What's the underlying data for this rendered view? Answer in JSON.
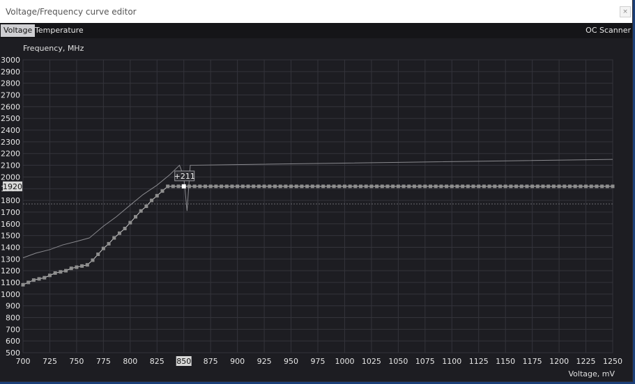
{
  "window": {
    "title": "Voltage/Frequency curve editor",
    "close_glyph": "×"
  },
  "tabs": [
    {
      "label": "Voltage",
      "active": true
    },
    {
      "label": "Temperature",
      "active": false
    }
  ],
  "oc_scanner_label": "OC Scanner",
  "colors": {
    "background": "#1d1d22",
    "grid": "#34343b",
    "curve": "#cfcfcf",
    "point": "#8e8e8e",
    "selected_point": "#ffffff"
  },
  "chart_data": {
    "type": "line",
    "xlabel": "Voltage, mV",
    "ylabel": "Frequency, MHz",
    "xlim": [
      700,
      1250
    ],
    "ylim": [
      500,
      3000
    ],
    "x_ticks": [
      700,
      725,
      750,
      775,
      800,
      825,
      850,
      875,
      900,
      925,
      950,
      975,
      1000,
      1025,
      1050,
      1075,
      1100,
      1125,
      1150,
      1175,
      1200,
      1225,
      1250
    ],
    "y_ticks": [
      500,
      600,
      700,
      800,
      900,
      1000,
      1100,
      1200,
      1300,
      1400,
      1500,
      1600,
      1700,
      1800,
      1900,
      2000,
      2100,
      2200,
      2300,
      2400,
      2500,
      2600,
      2700,
      2800,
      2900,
      3000
    ],
    "grid": true,
    "selected_voltage_label": "850",
    "selected_frequency_label": "1920",
    "offset_label": "+211",
    "reference_line_mhz": 1770,
    "series": [
      {
        "role": "reference curve",
        "x": [
          700,
          712,
          725,
          737,
          750,
          762,
          775,
          787,
          800,
          812,
          825,
          837,
          846,
          850,
          853,
          856,
          1250
        ],
        "y": [
          1310,
          1350,
          1380,
          1420,
          1450,
          1480,
          1580,
          1660,
          1760,
          1850,
          1930,
          2020,
          2100,
          2000,
          1710,
          2100,
          2150
        ]
      },
      {
        "role": "adjusted curve points",
        "x": [
          700,
          705,
          710,
          715,
          720,
          725,
          730,
          735,
          740,
          745,
          750,
          755,
          760,
          765,
          770,
          775,
          780,
          785,
          790,
          795,
          800,
          805,
          810,
          815,
          820,
          825,
          830,
          835,
          840,
          845,
          850,
          855,
          860,
          865,
          870,
          875,
          880,
          885,
          890,
          895,
          900,
          905,
          910,
          915,
          920,
          925,
          930,
          935,
          940,
          945,
          950,
          955,
          960,
          965,
          970,
          975,
          980,
          985,
          990,
          995,
          1000,
          1005,
          1010,
          1015,
          1020,
          1025,
          1030,
          1035,
          1040,
          1045,
          1050,
          1055,
          1060,
          1065,
          1070,
          1075,
          1080,
          1085,
          1090,
          1095,
          1100,
          1105,
          1110,
          1115,
          1120,
          1125,
          1130,
          1135,
          1140,
          1145,
          1150,
          1155,
          1160,
          1165,
          1170,
          1175,
          1180,
          1185,
          1190,
          1195,
          1200,
          1205,
          1210,
          1215,
          1220,
          1225,
          1230,
          1235,
          1240,
          1245,
          1250
        ],
        "y": [
          1080,
          1100,
          1120,
          1130,
          1140,
          1160,
          1180,
          1190,
          1200,
          1220,
          1230,
          1240,
          1250,
          1290,
          1340,
          1390,
          1430,
          1480,
          1520,
          1560,
          1610,
          1660,
          1710,
          1750,
          1800,
          1840,
          1880,
          1920,
          1920,
          1920,
          1920,
          1920,
          1920,
          1920,
          1920,
          1920,
          1920,
          1920,
          1920,
          1920,
          1920,
          1920,
          1920,
          1920,
          1920,
          1920,
          1920,
          1920,
          1920,
          1920,
          1920,
          1920,
          1920,
          1920,
          1920,
          1920,
          1920,
          1920,
          1920,
          1920,
          1920,
          1920,
          1920,
          1920,
          1920,
          1920,
          1920,
          1920,
          1920,
          1920,
          1920,
          1920,
          1920,
          1920,
          1920,
          1920,
          1920,
          1920,
          1920,
          1920,
          1920,
          1920,
          1920,
          1920,
          1920,
          1920,
          1920,
          1920,
          1920,
          1920,
          1920,
          1920,
          1920,
          1920,
          1920,
          1920,
          1920,
          1920,
          1920,
          1920,
          1920,
          1920,
          1920,
          1920,
          1920,
          1920,
          1920,
          1920,
          1920,
          1920,
          1920
        ]
      }
    ]
  }
}
